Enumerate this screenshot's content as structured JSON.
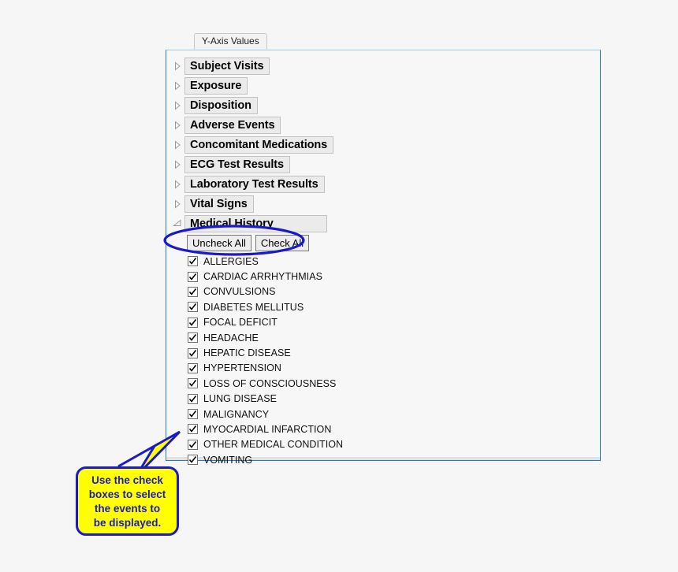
{
  "tab": {
    "label": "Y-Axis Values"
  },
  "tree": {
    "categories": [
      {
        "label": "Subject Visits",
        "expanded": false,
        "twisty": "collapsed-triangle-icon"
      },
      {
        "label": "Exposure",
        "expanded": false,
        "twisty": "collapsed-triangle-icon"
      },
      {
        "label": "Disposition",
        "expanded": false,
        "twisty": "collapsed-triangle-icon"
      },
      {
        "label": "Adverse Events",
        "expanded": false,
        "twisty": "collapsed-triangle-icon"
      },
      {
        "label": "Concomitant Medications",
        "expanded": false,
        "twisty": "collapsed-triangle-icon"
      },
      {
        "label": "ECG Test Results",
        "expanded": false,
        "twisty": "collapsed-triangle-icon"
      },
      {
        "label": "Laboratory Test Results",
        "expanded": false,
        "twisty": "collapsed-triangle-icon"
      },
      {
        "label": "Vital Signs",
        "expanded": false,
        "twisty": "collapsed-triangle-icon"
      },
      {
        "label": "Medical History",
        "expanded": true,
        "twisty": "expanded-triangle-icon"
      }
    ]
  },
  "buttons": {
    "uncheck_all": "Uncheck All",
    "check_all": "Check All"
  },
  "checkbox_items": [
    {
      "label": "ALLERGIES",
      "checked": true
    },
    {
      "label": "CARDIAC ARRHYTHMIAS",
      "checked": true
    },
    {
      "label": "CONVULSIONS",
      "checked": true
    },
    {
      "label": "DIABETES MELLITUS",
      "checked": true
    },
    {
      "label": "FOCAL DEFICIT",
      "checked": true
    },
    {
      "label": "HEADACHE",
      "checked": true
    },
    {
      "label": "HEPATIC DISEASE",
      "checked": true
    },
    {
      "label": "HYPERTENSION",
      "checked": true
    },
    {
      "label": "LOSS OF CONSCIOUSNESS",
      "checked": true
    },
    {
      "label": "LUNG DISEASE",
      "checked": true
    },
    {
      "label": "MALIGNANCY",
      "checked": true
    },
    {
      "label": "MYOCARDIAL INFARCTION",
      "checked": true
    },
    {
      "label": "OTHER MEDICAL CONDITION",
      "checked": true
    },
    {
      "label": "VOMITING",
      "checked": true
    }
  ],
  "annotations": {
    "ellipse": {
      "name": "highlight-ellipse",
      "color": "#1a1aca"
    },
    "callout": {
      "lines": [
        "Use the check",
        "boxes to select",
        "the events to",
        "be displayed."
      ],
      "fill": "#ffff00",
      "stroke": "#1a1aca"
    }
  },
  "colors": {
    "page_background": "#f6f6f6",
    "panel_border": "#1e7fc4",
    "panel_background": "#f7f7f7",
    "node_label_background": "#ebebeb",
    "annotation_blue": "#1a1aca",
    "callout_yellow": "#ffff00"
  }
}
